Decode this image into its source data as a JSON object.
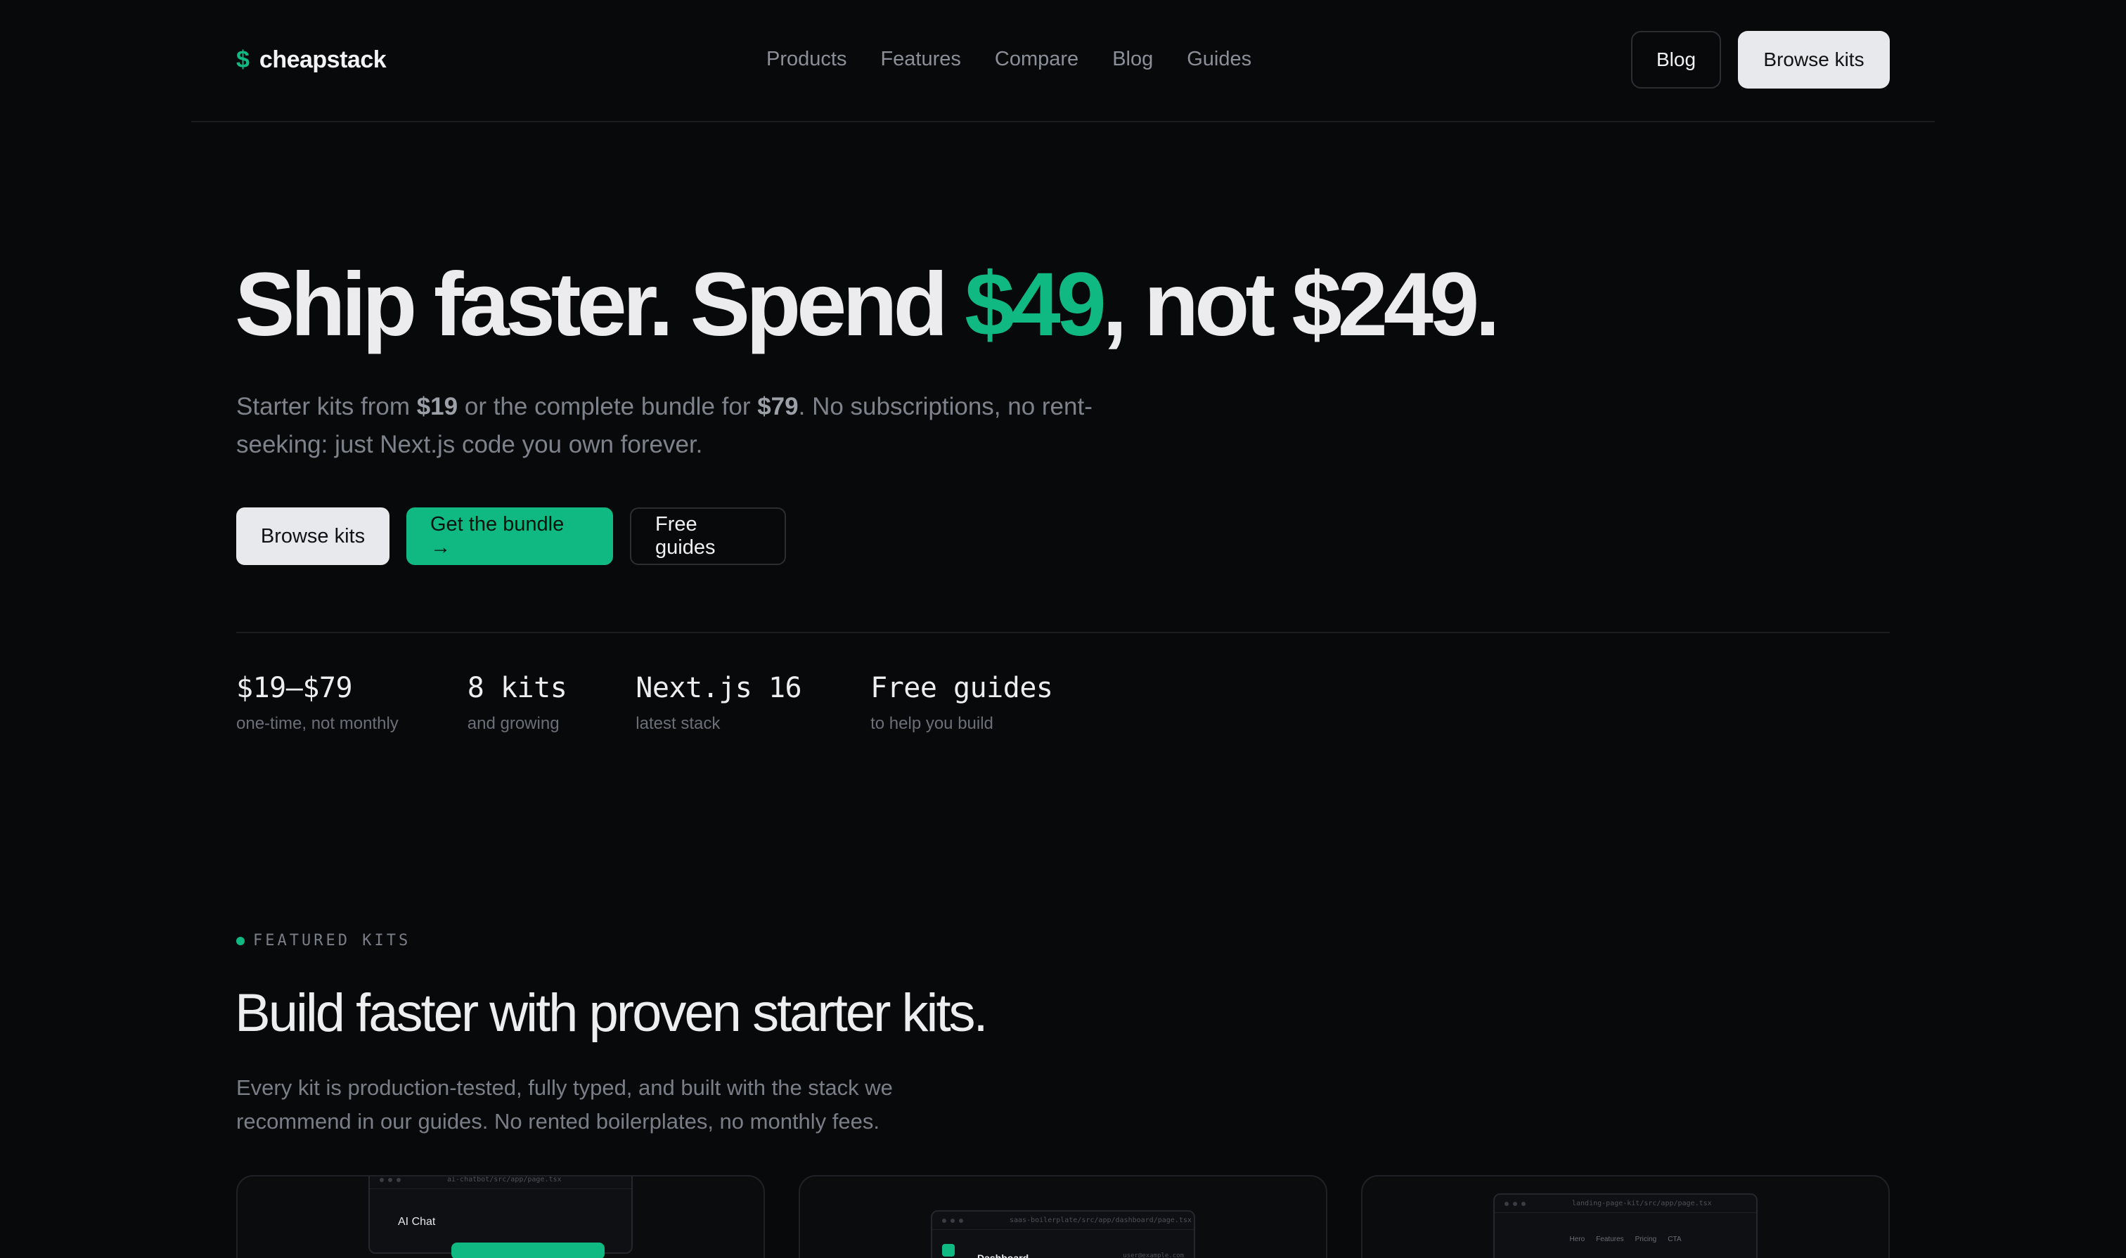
{
  "nav": {
    "logo_symbol": "$",
    "logo_text": "cheapstack",
    "links": [
      "Products",
      "Features",
      "Compare",
      "Blog",
      "Guides"
    ],
    "blog_button": "Blog",
    "browse_button": "Browse kits"
  },
  "hero": {
    "title_part1": "Ship faster. Spend ",
    "title_accent": "$49",
    "title_part2": ", not $249.",
    "sub_1": "Starter kits from ",
    "sub_price1": "$19",
    "sub_2": " or the complete bundle for ",
    "sub_price2": "$79",
    "sub_3": ". No subscriptions, no rent-seeking: just Next.js code you own forever.",
    "cta_browse": "Browse kits",
    "cta_bundle": "Get the bundle →",
    "cta_guides": "Free guides"
  },
  "stats": [
    {
      "value": "$19–$79",
      "label": "one-time, not monthly"
    },
    {
      "value": "8 kits",
      "label": "and growing"
    },
    {
      "value": "Next.js 16",
      "label": "latest stack"
    },
    {
      "value": "Free guides",
      "label": "to help you build"
    }
  ],
  "featured": {
    "eyebrow": "FEATURED KITS",
    "title": "Build faster with proven starter kits.",
    "subtitle": "Every kit is production-tested, fully typed, and built with the stack we recommend in our guides. No rented boilerplates, no monthly fees."
  },
  "cards": [
    {
      "path": "ai-chatbot/src/app/page.tsx",
      "heading": "AI Chat"
    },
    {
      "path": "saas-boilerplate/src/app/dashboard/page.tsx",
      "heading": "Dashboard",
      "meta": "user@example.com"
    },
    {
      "path": "landing-page-kit/src/app/page.tsx",
      "nav": [
        "Hero",
        "Features",
        "Pricing",
        "CTA"
      ]
    }
  ],
  "colors": {
    "accent": "#10b981",
    "background": "#08090b",
    "text": "#ececee",
    "muted": "#7e828a"
  }
}
